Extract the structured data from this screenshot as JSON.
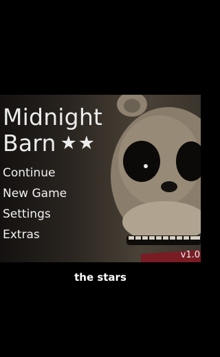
{
  "game": {
    "title_line1": "Midnight",
    "title_line2": "Barn",
    "stars": "★★",
    "version": "v1.0"
  },
  "menu": {
    "items": [
      {
        "label": "Continue"
      },
      {
        "label": "New Game"
      },
      {
        "label": "Settings"
      },
      {
        "label": "Extras"
      }
    ]
  },
  "caption": "the stars",
  "colors": {
    "background": "#000000",
    "bear_fur": "#8a7d6b",
    "bow_tie": "#7a1c24",
    "text": "#f2f2f2"
  },
  "icons": [
    "animatronic-bear-art",
    "star-icon"
  ]
}
